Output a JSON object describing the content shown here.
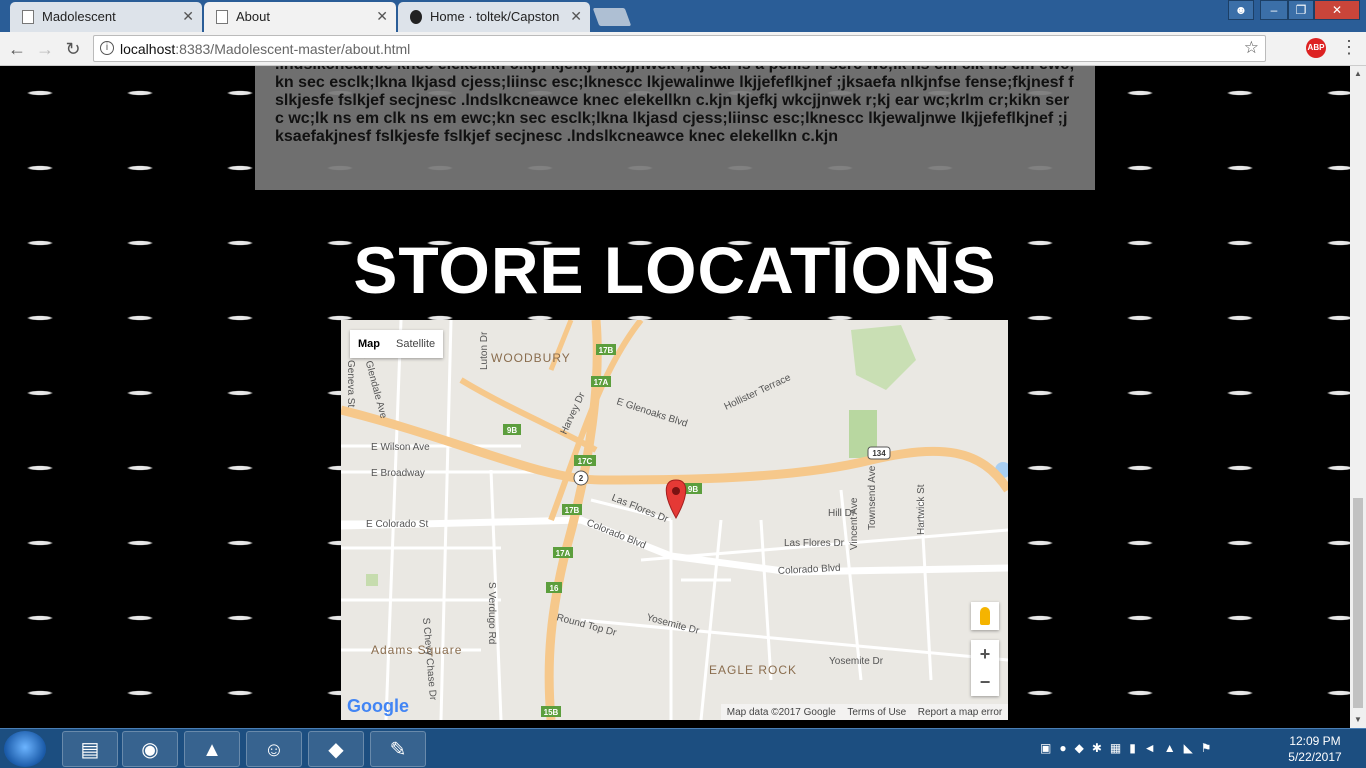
{
  "browser": {
    "tabs": [
      {
        "label": "Madolescent",
        "active": false
      },
      {
        "label": "About",
        "active": true
      },
      {
        "label": "Home · toltek/Capstone",
        "active": false
      }
    ],
    "url_host": "localhost",
    "url_rest": ":8383/Madolescent-master/about.html",
    "abp_label": "ABP"
  },
  "page": {
    "about_text": ".lndslkcneawce knec elekellkn c.kjn kjefkj wkcjjnwek r;kj ear is a penis n serc wc;lk ns em clk ns em ewc;kn sec esclk;lkna lkjasd cjess;liinsc esc;lknescc lkjewalinwe lkjjefeflkjnef ;jksaefa nlkjnfse fense;fkjnesf fslkjesfe fslkjef secjnesc .lndslkcneawce knec elekellkn c.kjn kjefkj wkcjjnwek r;kj ear wc;krlm cr;kikn serc wc;lk ns em clk ns em ewc;kn sec esclk;lkna lkjasd cjess;liinsc esc;lknescc lkjewaljnwe lkjjefeflkjnef ;jksaefakjnesf fslkjesfe fslkjef secjnesc .lndslkcneawce knec elekellkn c.kjn",
    "heading": "STORE LOCATIONS"
  },
  "map": {
    "map_btn": "Map",
    "satellite_btn": "Satellite",
    "zoom_in": "+",
    "zoom_out": "−",
    "logo": "Google",
    "attribution": "Map data ©2017 Google",
    "terms": "Terms of Use",
    "report": "Report a map error",
    "labels": {
      "woodbury": "WOODBURY",
      "adams": "Adams Square",
      "eagle": "EAGLE ROCK",
      "wilson": "E Wilson Ave",
      "broadway": "E Broadway",
      "colorado_st": "E Colorado St",
      "colorado_blvd": "Colorado Blvd",
      "colorado_blvd2": "Colorado Blvd",
      "lasflores": "Las Flores Dr",
      "lasflores2": "Las Flores Dr",
      "glenoaks": "E Glenoaks Blvd",
      "hollister": "Hollister Terrace",
      "harvey": "Harvey Dr",
      "verdugo": "S Verdugo Rd",
      "chevy": "S Chevy Chase Dr",
      "yosemite": "Yosemite Dr",
      "yosemite2": "Yosemite Dr",
      "roundtop": "Round Top Dr",
      "hill": "Hill Dr",
      "vincent": "Vincent Ave",
      "townsend": "Townsend Ave",
      "hartwick": "Hartwick St",
      "luton": "Luton Dr",
      "geneva": "Geneva St",
      "glendale": "N Glendale Ave"
    },
    "shields": [
      "17B",
      "17A",
      "9B",
      "17C",
      "2",
      "9B",
      "17B",
      "17A",
      "16",
      "15B",
      "134"
    ]
  },
  "taskbar": {
    "time": "12:09 PM",
    "date": "5/22/2017"
  }
}
